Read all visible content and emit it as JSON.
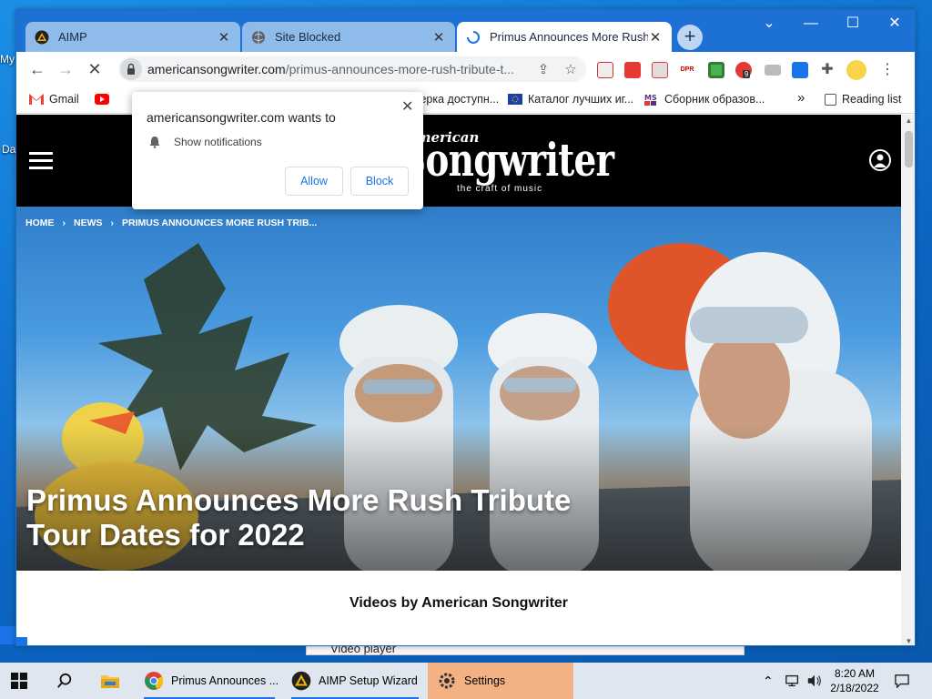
{
  "desktop": {
    "label_my": "My",
    "label_da": "Da"
  },
  "background_window": {
    "label": "Video player"
  },
  "browser": {
    "tabs": [
      {
        "title": "AIMP",
        "close": "✕"
      },
      {
        "title": "Site Blocked",
        "close": "✕"
      },
      {
        "title": "Primus Announces More Rush Tr",
        "close": "✕"
      }
    ],
    "new_tab": "+",
    "window_controls": {
      "menu": "⌄",
      "minimize": "—",
      "maximize": "☐",
      "close": "✕"
    },
    "nav": {
      "back": "←",
      "forward": "→",
      "stop": "✕"
    },
    "url_domain": "americansongwriter.com",
    "url_path": "/primus-announces-more-rush-tribute-t...",
    "ext_badge": "9",
    "bookmarks": [
      {
        "label": "Gmail"
      },
      {
        "label": "оверка доступн..."
      },
      {
        "label": "Каталог лучших иг..."
      },
      {
        "label": "Сборник образов..."
      }
    ],
    "bookmarks_more": "»",
    "reading_list": "Reading list"
  },
  "popup": {
    "title": "americansongwriter.com wants to",
    "close": "✕",
    "permission": "Show notifications",
    "allow": "Allow",
    "block": "Block"
  },
  "site": {
    "logo_small": "American",
    "logo_big": "Songwriter",
    "logo_tag": "the craft of music",
    "breadcrumb": [
      "HOME",
      "NEWS",
      "PRIMUS ANNOUNCES MORE RUSH TRIB..."
    ],
    "breadcrumb_sep": "›",
    "hero_title_line1": "Primus Announces More Rush Tribute",
    "hero_title_line2": "Tour Dates for 2022",
    "videos_heading": "Videos by American Songwriter"
  },
  "taskbar": {
    "items": [
      {
        "label": "Primus Announces ..."
      },
      {
        "label": "AIMP Setup Wizard"
      },
      {
        "label": "Settings"
      }
    ],
    "time": "8:20 AM",
    "date": "2/18/2022"
  },
  "colors": {
    "titlebar": "#1d70d4",
    "accent": "#1a73e8",
    "settings_highlight": "#f4b183"
  }
}
